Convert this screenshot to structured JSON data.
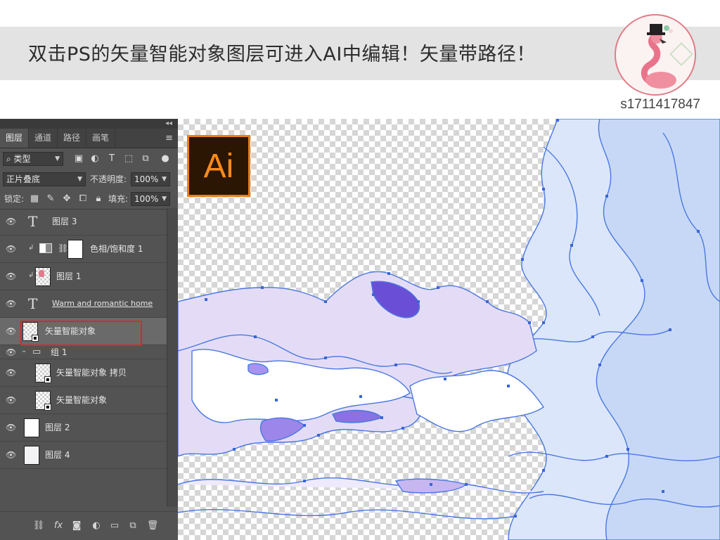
{
  "banner": {
    "text": "双击PS的矢量智能对象图层可进入AI中编辑！矢量带路径！"
  },
  "user": {
    "id": "s1711417847"
  },
  "ai_badge": {
    "label": "Ai",
    "accent": "#ea7e14"
  },
  "panel": {
    "tabs": [
      {
        "label": "图层",
        "active": true
      },
      {
        "label": "通道",
        "active": false
      },
      {
        "label": "路径",
        "active": false
      },
      {
        "label": "画笔",
        "active": false
      }
    ],
    "filter": {
      "value": "类型"
    },
    "blend_mode": {
      "value": "正片叠底"
    },
    "opacity": {
      "label": "不透明度:",
      "value": "100%"
    },
    "lock": {
      "label": "锁定:"
    },
    "fill": {
      "label": "填充:",
      "value": "100%"
    },
    "layers": [
      {
        "name": "图层 3",
        "kind": "text"
      },
      {
        "name": "色相/饱和度 1",
        "kind": "adjustment"
      },
      {
        "name": "图层 1",
        "kind": "pixel"
      },
      {
        "name": "Warm and romantic home",
        "kind": "text"
      },
      {
        "name": "矢量智能对象",
        "kind": "smart",
        "selected": true
      },
      {
        "name": "组 1",
        "kind": "group"
      },
      {
        "name": "矢量智能对象 拷贝",
        "kind": "smart"
      },
      {
        "name": "矢量智能对象",
        "kind": "smart"
      },
      {
        "name": "图层 2",
        "kind": "white"
      },
      {
        "name": "图层 4",
        "kind": "white"
      }
    ]
  },
  "colors": {
    "panel_bg": "#535353",
    "highlight": "#d9262c",
    "path_blue": "#4a78e0",
    "fill_lavender": "#e4dcf7",
    "fill_blue": "#dbe6fb",
    "fill_purple": "#6a4fd6"
  }
}
